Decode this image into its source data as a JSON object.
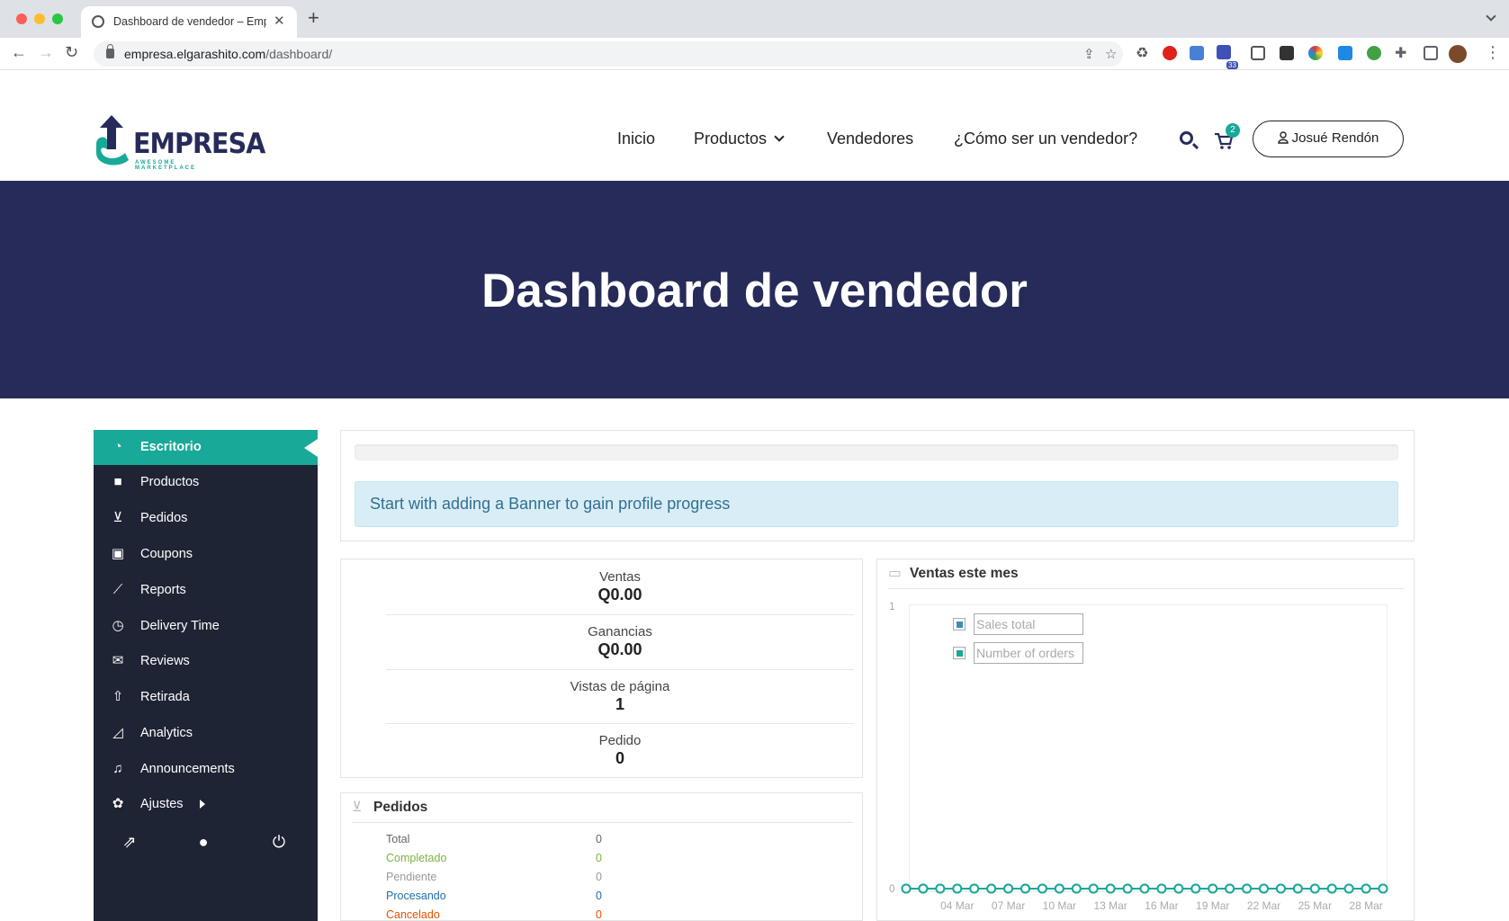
{
  "browser": {
    "tab_title": "Dashboard de vendedor – Emp",
    "url_domain": "empresa.elgarashito.com",
    "url_path": "/dashboard/",
    "extension_badge": "33"
  },
  "site": {
    "logo_text": "EMPRESA",
    "logo_tagline": "AWESOME MARKETPLACE",
    "nav": {
      "inicio": "Inicio",
      "productos": "Productos",
      "vendedores": "Vendedores",
      "como": "¿Cómo ser un vendedor?"
    },
    "cart_count": "2",
    "user_name": "Josué Rendón"
  },
  "hero": {
    "title": "Dashboard de vendedor"
  },
  "sidebar": {
    "items": [
      {
        "label": "Escritorio",
        "icon": "dashboard-icon"
      },
      {
        "label": "Productos",
        "icon": "briefcase-icon"
      },
      {
        "label": "Pedidos",
        "icon": "cart-icon"
      },
      {
        "label": "Coupons",
        "icon": "gift-icon"
      },
      {
        "label": "Reports",
        "icon": "line-chart-icon"
      },
      {
        "label": "Delivery Time",
        "icon": "clock-icon"
      },
      {
        "label": "Reviews",
        "icon": "comments-icon"
      },
      {
        "label": "Retirada",
        "icon": "upload-icon"
      },
      {
        "label": "Analytics",
        "icon": "area-chart-icon"
      },
      {
        "label": "Announcements",
        "icon": "bell-icon"
      },
      {
        "label": "Ajustes",
        "icon": "gear-icon"
      }
    ]
  },
  "progress": {
    "percent": 0,
    "alert": "Start with adding a Banner to gain profile progress"
  },
  "stats": {
    "ventas_label": "Ventas",
    "ventas_value": "Q0.00",
    "ganancias_label": "Ganancias",
    "ganancias_value": "Q0.00",
    "vistas_label": "Vistas de página",
    "vistas_value": "1",
    "pedido_label": "Pedido",
    "pedido_value": "0"
  },
  "orders": {
    "title": "Pedidos",
    "rows": [
      {
        "label": "Total",
        "value": "0",
        "color": "#666666"
      },
      {
        "label": "Completado",
        "value": "0",
        "color": "#7cb342"
      },
      {
        "label": "Pendiente",
        "value": "0",
        "color": "#999999"
      },
      {
        "label": "Procesando",
        "value": "0",
        "color": "#1e6fa8"
      },
      {
        "label": "Cancelado",
        "value": "0",
        "color": "#e65100"
      }
    ]
  },
  "chart_data": {
    "type": "line",
    "title": "Ventas este mes",
    "legend": [
      "Sales total",
      "Number of orders"
    ],
    "legend_colors": [
      "#3c8dbc",
      "#18a999"
    ],
    "y_ticks": [
      "1",
      "0"
    ],
    "ylim": [
      0,
      1
    ],
    "x_tick_labels": [
      "04 Mar",
      "07 Mar",
      "10 Mar",
      "13 Mar",
      "16 Mar",
      "19 Mar",
      "22 Mar",
      "25 Mar",
      "28 Mar"
    ],
    "x": [
      "01 Mar",
      "02 Mar",
      "03 Mar",
      "04 Mar",
      "05 Mar",
      "06 Mar",
      "07 Mar",
      "08 Mar",
      "09 Mar",
      "10 Mar",
      "11 Mar",
      "12 Mar",
      "13 Mar",
      "14 Mar",
      "15 Mar",
      "16 Mar",
      "17 Mar",
      "18 Mar",
      "19 Mar",
      "20 Mar",
      "21 Mar",
      "22 Mar",
      "23 Mar",
      "24 Mar",
      "25 Mar",
      "26 Mar",
      "27 Mar",
      "28 Mar",
      "29 Mar"
    ],
    "series": [
      {
        "name": "Sales total",
        "values": [
          0,
          0,
          0,
          0,
          0,
          0,
          0,
          0,
          0,
          0,
          0,
          0,
          0,
          0,
          0,
          0,
          0,
          0,
          0,
          0,
          0,
          0,
          0,
          0,
          0,
          0,
          0,
          0,
          0
        ]
      },
      {
        "name": "Number of orders",
        "values": [
          0,
          0,
          0,
          0,
          0,
          0,
          0,
          0,
          0,
          0,
          0,
          0,
          0,
          0,
          0,
          0,
          0,
          0,
          0,
          0,
          0,
          0,
          0,
          0,
          0,
          0,
          0,
          0,
          0
        ]
      }
    ]
  }
}
